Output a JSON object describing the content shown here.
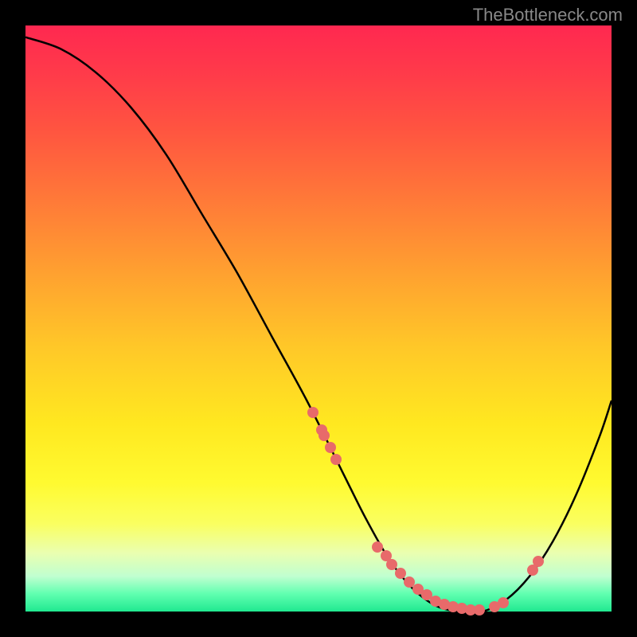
{
  "watermark": "TheBottleneck.com",
  "chart_data": {
    "type": "line",
    "title": "",
    "xlabel": "",
    "ylabel": "",
    "xlim": [
      0,
      100
    ],
    "ylim": [
      0,
      100
    ],
    "series": [
      {
        "name": "curve",
        "x": [
          0,
          6,
          12,
          18,
          24,
          30,
          36,
          42,
          48,
          54,
          58,
          62,
          66,
          70,
          74,
          78,
          82,
          86,
          90,
          94,
          98,
          100
        ],
        "y": [
          98,
          96,
          92,
          86,
          78,
          68,
          58,
          47,
          36,
          24,
          16,
          9,
          4,
          1,
          0,
          0,
          2,
          6,
          12,
          20,
          30,
          36
        ]
      }
    ],
    "markers": {
      "name": "highlight-points",
      "x": [
        49,
        50.5,
        51,
        52,
        53,
        60,
        61.5,
        62.5,
        64,
        65.5,
        67,
        68.5,
        70,
        71.5,
        73,
        74.5,
        76,
        77.5,
        80,
        81.5,
        86.5,
        87.5
      ],
      "y": [
        34,
        31,
        30,
        28,
        26,
        11,
        9.5,
        8,
        6.5,
        5,
        3.8,
        2.8,
        1.8,
        1.2,
        0.8,
        0.5,
        0.3,
        0.3,
        0.8,
        1.5,
        7,
        8.5
      ]
    },
    "background_gradient": {
      "top": "#ff2850",
      "middle": "#ffe820",
      "bottom": "#20e890"
    }
  }
}
